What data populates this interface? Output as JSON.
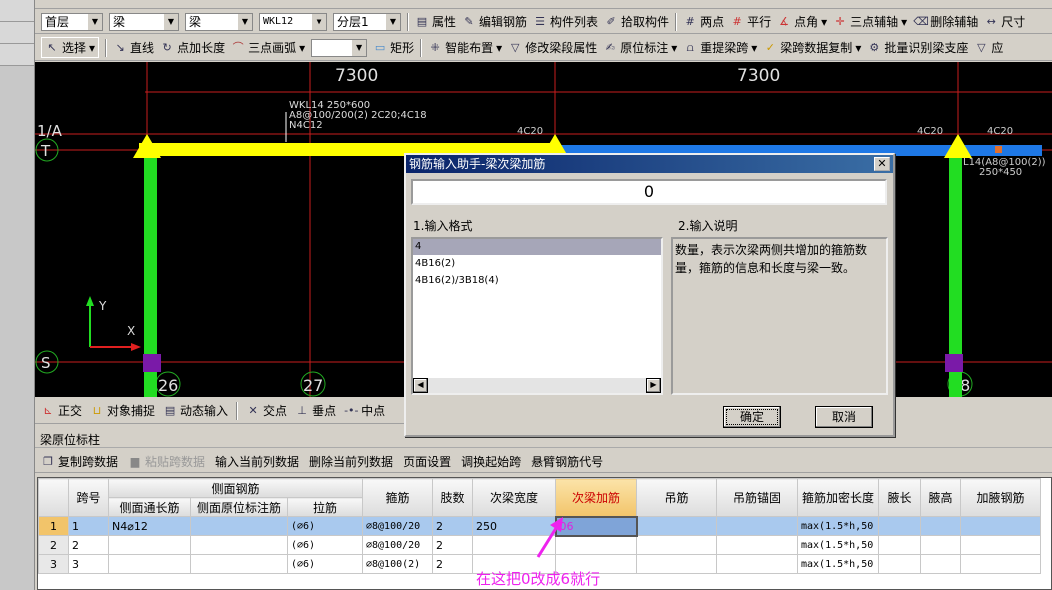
{
  "toolbar1": {
    "floor": "首层",
    "category": "梁",
    "type": "梁",
    "component": "WKL12",
    "layer": "分层1",
    "buttons": [
      "属性",
      "编辑钢筋",
      "构件列表",
      "拾取构件",
      "两点",
      "平行",
      "点角",
      "三点辅轴",
      "删除辅轴",
      "尺寸"
    ]
  },
  "toolbar2": {
    "select": "选择",
    "buttons": [
      "直线",
      "点加长度",
      "三点画弧"
    ],
    "combo": "",
    "buttons2": [
      "矩形",
      "智能布置",
      "修改梁段属性",
      "原位标注",
      "重提梁跨",
      "梁跨数据复制",
      "批量识别梁支座",
      "应"
    ]
  },
  "canvas": {
    "dims": [
      "7300",
      "7300"
    ],
    "axes": [
      "1/A",
      "T",
      "S",
      "26",
      "27",
      "28"
    ],
    "beam_label": [
      "WKL14 250*600",
      "A8@100/200(2) 2C20;4C18",
      "N4C12"
    ],
    "rebar_labels": [
      "4C20",
      "4C20",
      "4C20"
    ],
    "beam_label2": [
      "L14(A8@100(2))",
      "250*450"
    ],
    "ucs": {
      "x": "X",
      "y": "Y"
    },
    "colors": {
      "beam1": "#ffff00",
      "beam2": "#1e78e6",
      "column": "#22dd22",
      "axis": "#c81e1e"
    }
  },
  "snapbar": [
    "正交",
    "对象捕捉",
    "动态输入",
    "交点",
    "垂点",
    "中点"
  ],
  "panel": {
    "title": "梁原位标柱",
    "toolbar": [
      "复制跨数据",
      "粘贴跨数据",
      "输入当前列数据",
      "删除当前列数据",
      "页面设置",
      "调换起始跨",
      "悬臂钢筋代号"
    ]
  },
  "dialog": {
    "title": "钢筋输入助手-梁次梁加筋",
    "value": "0",
    "format_label": "1.输入格式",
    "desc_label": "2.输入说明",
    "formats": [
      "4",
      "4B16(2)",
      "4B16(2)/3B18(4)"
    ],
    "description": "数量，表示次梁两侧共增加的箍筋数量，箍筋的信息和长度与梁一致。",
    "ok": "确定",
    "cancel": "取消"
  },
  "table": {
    "group_header": "侧面钢筋",
    "headers": [
      "跨号",
      "侧面通长筋",
      "侧面原位标注筋",
      "拉筋",
      "箍筋",
      "肢数",
      "次梁宽度",
      "次梁加筋",
      "吊筋",
      "吊筋锚固",
      "箍筋加密长度",
      "腋长",
      "腋高",
      "加腋钢筋"
    ],
    "rows": [
      {
        "n": "1",
        "cells": [
          "1",
          "N4⌀12",
          "",
          "(⌀6)",
          "⌀8@100/20",
          "2",
          "250",
          "06",
          "",
          "",
          "max(1.5*h,50",
          "",
          "",
          ""
        ]
      },
      {
        "n": "2",
        "cells": [
          "2",
          "",
          "",
          "(⌀6)",
          "⌀8@100/20",
          "2",
          "",
          "",
          "",
          "",
          "max(1.5*h,50",
          "",
          "",
          ""
        ]
      },
      {
        "n": "3",
        "cells": [
          "3",
          "",
          "",
          "(⌀6)",
          "⌀8@100(2)",
          "2",
          "",
          "",
          "",
          "",
          "max(1.5*h,50",
          "",
          "",
          ""
        ]
      }
    ]
  },
  "annotation": {
    "text": "在这把0改成6就行",
    "color": "#ee22ee"
  }
}
